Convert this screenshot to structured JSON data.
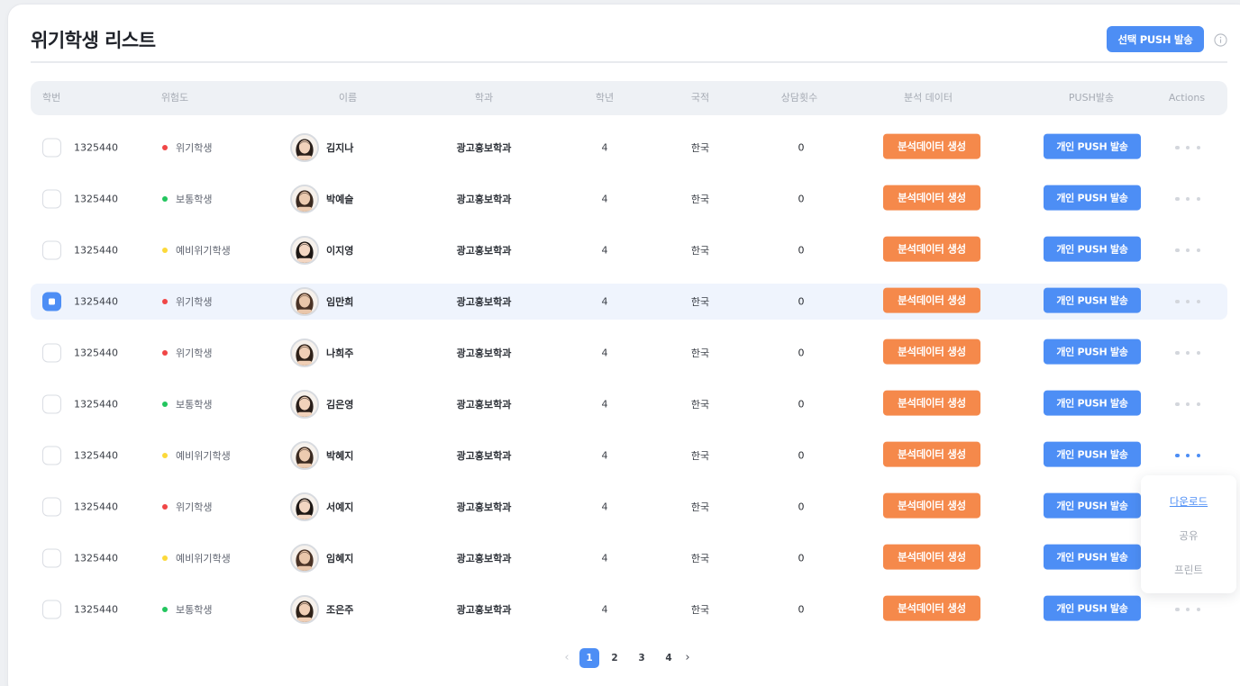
{
  "page": {
    "title": "위기학생 리스트",
    "select_push_label": "선택 PUSH 발송"
  },
  "table": {
    "headers": [
      "학번",
      "위험도",
      "이름",
      "학과",
      "학년",
      "국적",
      "상담횟수",
      "분석 데이터",
      "PUSH발송",
      "Actions"
    ],
    "analysis_button_label": "분석데이터 생성",
    "push_button_label": "개인 PUSH 발송",
    "rows": [
      {
        "id": "1325440",
        "risk": "위기학생",
        "name": "김지나",
        "dept": "광고홍보학과",
        "grade": "4",
        "nationality": "한국",
        "counsel": "0",
        "selected": false
      },
      {
        "id": "1325440",
        "risk": "보통학생",
        "name": "박예슬",
        "dept": "광고홍보학과",
        "grade": "4",
        "nationality": "한국",
        "counsel": "0",
        "selected": false
      },
      {
        "id": "1325440",
        "risk": "예비위기학생",
        "name": "이지영",
        "dept": "광고홍보학과",
        "grade": "4",
        "nationality": "한국",
        "counsel": "0",
        "selected": false
      },
      {
        "id": "1325440",
        "risk": "위기학생",
        "name": "임만희",
        "dept": "광고홍보학과",
        "grade": "4",
        "nationality": "한국",
        "counsel": "0",
        "selected": true
      },
      {
        "id": "1325440",
        "risk": "위기학생",
        "name": "나희주",
        "dept": "광고홍보학과",
        "grade": "4",
        "nationality": "한국",
        "counsel": "0",
        "selected": false
      },
      {
        "id": "1325440",
        "risk": "보통학생",
        "name": "김은영",
        "dept": "광고홍보학과",
        "grade": "4",
        "nationality": "한국",
        "counsel": "0",
        "selected": false
      },
      {
        "id": "1325440",
        "risk": "예비위기학생",
        "name": "박혜지",
        "dept": "광고홍보학과",
        "grade": "4",
        "nationality": "한국",
        "counsel": "0",
        "selected": false
      },
      {
        "id": "1325440",
        "risk": "위기학생",
        "name": "서예지",
        "dept": "광고홍보학과",
        "grade": "4",
        "nationality": "한국",
        "counsel": "0",
        "selected": false
      },
      {
        "id": "1325440",
        "risk": "예비위기학생",
        "name": "임혜지",
        "dept": "광고홍보학과",
        "grade": "4",
        "nationality": "한국",
        "counsel": "0",
        "selected": false
      },
      {
        "id": "1325440",
        "risk": "보통학생",
        "name": "조은주",
        "dept": "광고홍보학과",
        "grade": "4",
        "nationality": "한국",
        "counsel": "0",
        "selected": false
      }
    ]
  },
  "risk_colors": {
    "위기학생": "#f04646",
    "보통학생": "#22c55e",
    "예비위기학생": "#fcd93a"
  },
  "colors": {
    "primary": "#4d8ef5",
    "analysis": "#f5894b"
  },
  "dropdown": {
    "items": [
      "다운로드",
      "공유",
      "프린트"
    ],
    "active_index": 0,
    "open_row_index": 6
  },
  "pagination": {
    "pages": [
      "1",
      "2",
      "3",
      "4"
    ],
    "current": "1",
    "prev_icon": "chevron-left-icon",
    "next_icon": "chevron-right-icon"
  },
  "icons": {
    "info": "info-circle-icon",
    "more": "more-horizontal-icon"
  }
}
